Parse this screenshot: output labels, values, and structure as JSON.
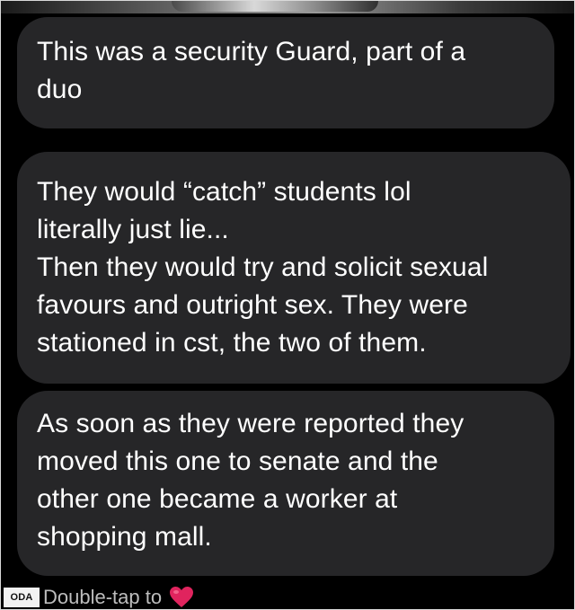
{
  "messages": [
    {
      "lines": [
        "This was a security Guard, part of a",
        "duo"
      ]
    },
    {
      "lines": [
        "They would “catch” students lol",
        "literally just lie...",
        "Then they would try and solicit sexual",
        "favours and outright sex. They were",
        "stationed in cst, the two of them."
      ]
    },
    {
      "lines": [
        "As soon as they were reported they",
        "moved this one to senate and the",
        "other one became a worker at",
        "shopping mall."
      ]
    }
  ],
  "footer": {
    "badge": "ODA",
    "hint": "Double-tap to",
    "reaction_icon": "heart-icon"
  },
  "colors": {
    "background": "#000000",
    "bubble": "#262628",
    "text": "#ffffff",
    "heart": "#e0245e"
  }
}
